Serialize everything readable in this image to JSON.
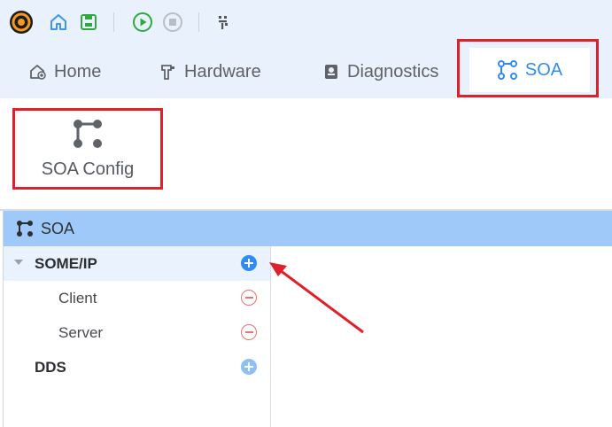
{
  "toolbar": {
    "icons": [
      "app-logo-icon",
      "home-icon",
      "save-icon",
      "run-icon",
      "stop-icon",
      "grid-icon"
    ]
  },
  "tabs": [
    {
      "label": "Home",
      "icon": "home-plus-icon"
    },
    {
      "label": "Hardware",
      "icon": "hardware-icon"
    },
    {
      "label": "Diagnostics",
      "icon": "diagnostics-icon"
    },
    {
      "label": "SOA",
      "icon": "soa-icon",
      "active": true
    }
  ],
  "ribbon": {
    "soa_config_label": "SOA Config"
  },
  "panel": {
    "title": "SOA",
    "tree": [
      {
        "label": "SOME/IP",
        "action": "add",
        "expanded": true,
        "selected": true
      },
      {
        "label": "Client",
        "action": "remove"
      },
      {
        "label": "Server",
        "action": "remove"
      },
      {
        "label": "DDS",
        "action": "add"
      }
    ]
  },
  "colors": {
    "accent": "#2f8cf0",
    "header_bg": "#9ec9f8",
    "topbar_bg": "#e8f1fc",
    "highlight_red": "#e0202a",
    "remove_red": "#f06f6f"
  }
}
